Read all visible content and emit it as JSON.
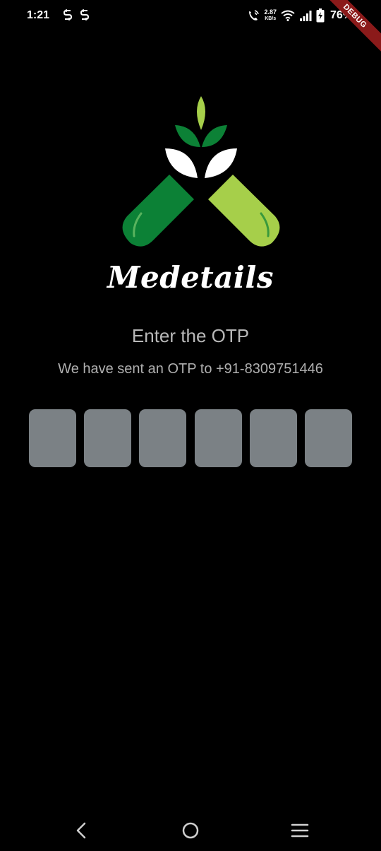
{
  "status_bar": {
    "time": "1:21",
    "net_speed_value": "2.87",
    "net_speed_unit": "KB/s",
    "battery": "76%",
    "icons": [
      "sync-s-icon",
      "sync-s-icon",
      "wifi-calling-icon",
      "wifi-icon",
      "signal-icon",
      "battery-charging-icon"
    ]
  },
  "debug_banner": "DEBUG",
  "logo": {
    "icon": "medicine-capsule-leaves-logo",
    "colors": {
      "dark_green": "#0c8136",
      "light_green": "#a6cf4a",
      "white": "#ffffff"
    }
  },
  "app_name": "Medetails",
  "otp": {
    "title": "Enter the OTP",
    "subtitle": "We have sent an OTP to +91-8309751446",
    "digits": [
      "",
      "",
      "",
      "",
      "",
      ""
    ],
    "box_color": "#7b8185"
  },
  "nav_bar": {
    "icons": [
      "back-icon",
      "home-icon",
      "recents-icon"
    ]
  }
}
